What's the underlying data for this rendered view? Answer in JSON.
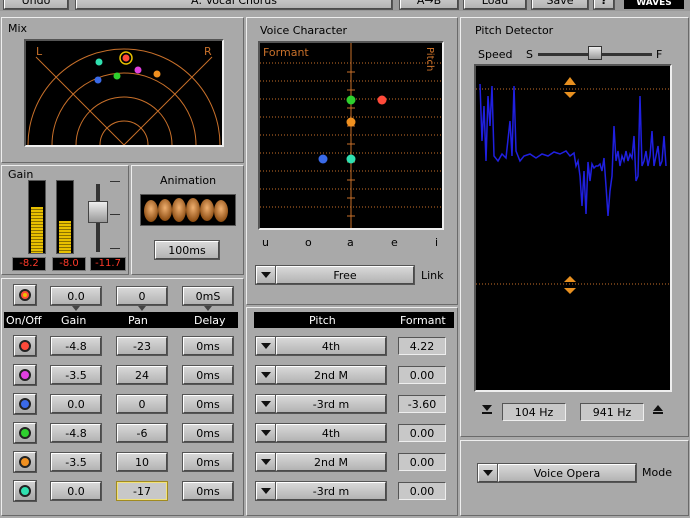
{
  "topbar": {
    "undo": "Undo",
    "preset_label": "A: Vocal Chorus",
    "ab": "A→B",
    "load": "Load",
    "save": "Save",
    "help": "?",
    "brand": "WAVES"
  },
  "mix": {
    "title": "Mix",
    "left": "L",
    "right": "R"
  },
  "gain": {
    "title": "Gain",
    "readouts": [
      "-8.2",
      "-8.0",
      "-11.7"
    ]
  },
  "animation": {
    "title": "Animation",
    "time": "100ms"
  },
  "voice_character": {
    "title": "Voice Character",
    "formant_label": "Formant",
    "pitch_label": "Pitch",
    "vowels": [
      "u",
      "o",
      "a",
      "e",
      "i"
    ],
    "link_mode": "Free",
    "link_label": "Link"
  },
  "pitch_detector": {
    "title": "Pitch Detector",
    "speed_label": "Speed",
    "slow": "S",
    "fast": "F",
    "low_hz": "104 Hz",
    "high_hz": "941 Hz",
    "mode_value": "Voice Opera",
    "mode_label": "Mode"
  },
  "master": {
    "gain": "0.0",
    "pan": "0",
    "delay": "0mS"
  },
  "headers": {
    "onoff": "On/Off",
    "gain": "Gain",
    "pan": "Pan",
    "delay": "Delay",
    "pitch": "Pitch",
    "formant": "Formant"
  },
  "voices": [
    {
      "color": "#ff4a3a",
      "gain": "-4.8",
      "pan": "-23",
      "delay": "0ms",
      "pitch": "4th",
      "formant": "4.22"
    },
    {
      "color": "#e040e0",
      "gain": "-3.5",
      "pan": "24",
      "delay": "0ms",
      "pitch": "2nd M",
      "formant": "0.00"
    },
    {
      "color": "#3a6ae8",
      "gain": "0.0",
      "pan": "0",
      "delay": "0ms",
      "pitch": "-3rd m",
      "formant": "-3.60"
    },
    {
      "color": "#2ed02e",
      "gain": "-4.8",
      "pan": "-6",
      "delay": "0ms",
      "pitch": "4th",
      "formant": "0.00"
    },
    {
      "color": "#f09020",
      "gain": "-3.5",
      "pan": "10",
      "delay": "0ms",
      "pitch": "2nd M",
      "formant": "0.00"
    },
    {
      "color": "#30e0b0",
      "gain": "0.0",
      "pan": "-17",
      "delay": "0ms",
      "pitch": "-3rd m",
      "formant": "0.00"
    }
  ],
  "colors": {
    "display_bg": "#000000",
    "grid_orange": "#c8702a",
    "waveform_blue": "#2020e0",
    "level_yellow": "#e8c000",
    "readout_red": "#ff3a2a"
  }
}
